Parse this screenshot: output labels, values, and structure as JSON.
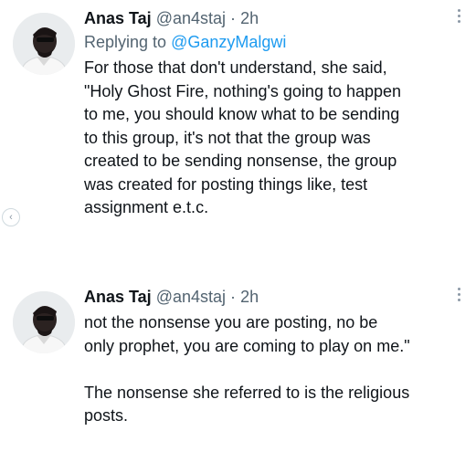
{
  "tweets": [
    {
      "name": "Anas Taj",
      "handle": "@an4staj",
      "dot": "·",
      "time": "2h",
      "reply_prefix": "Replying to ",
      "reply_to": "@GanzyMalgwi",
      "text": "For those that don't understand, she said,\n\"Holy Ghost Fire, nothing's going to happen\nto me, you should know what to be sending\nto this group, it's not that the group was\ncreated to be sending nonsense, the group\nwas created for posting things like, test\nassignment e.t.c."
    },
    {
      "name": "Anas Taj",
      "handle": "@an4staj",
      "dot": "·",
      "time": "2h",
      "text": "not the nonsense you are posting, no be\nonly prophet, you are coming to play on me.\"\n\nThe nonsense she referred to is the religious\nposts."
    }
  ],
  "side_indicator": {
    "icon": "chevron-left-icon",
    "glyph": "‹"
  },
  "colors": {
    "accent": "#1d9bf0",
    "secondary_text": "#536471",
    "primary_text": "#0f1419"
  }
}
